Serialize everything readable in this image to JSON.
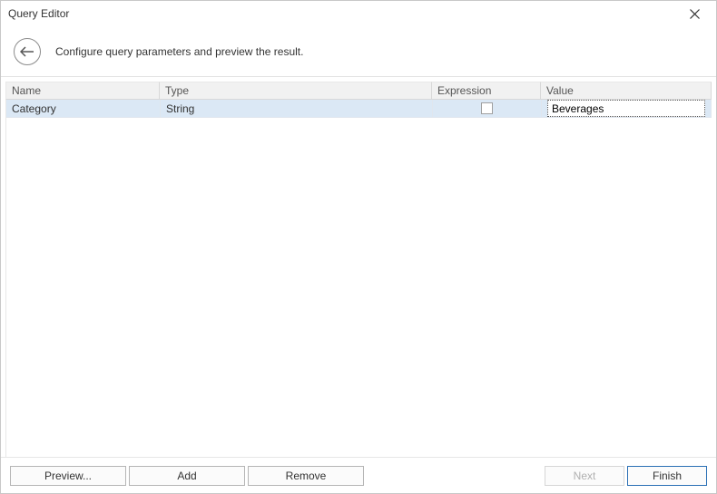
{
  "window": {
    "title": "Query Editor"
  },
  "subheader": {
    "text": "Configure query parameters and preview the result."
  },
  "columns": {
    "name": "Name",
    "type": "Type",
    "expression": "Expression",
    "value": "Value"
  },
  "rows": [
    {
      "name": "Category",
      "type": "String",
      "expression_checked": false,
      "value": "Beverages"
    }
  ],
  "buttons": {
    "preview": "Preview...",
    "add": "Add",
    "remove": "Remove",
    "next": "Next",
    "finish": "Finish"
  }
}
